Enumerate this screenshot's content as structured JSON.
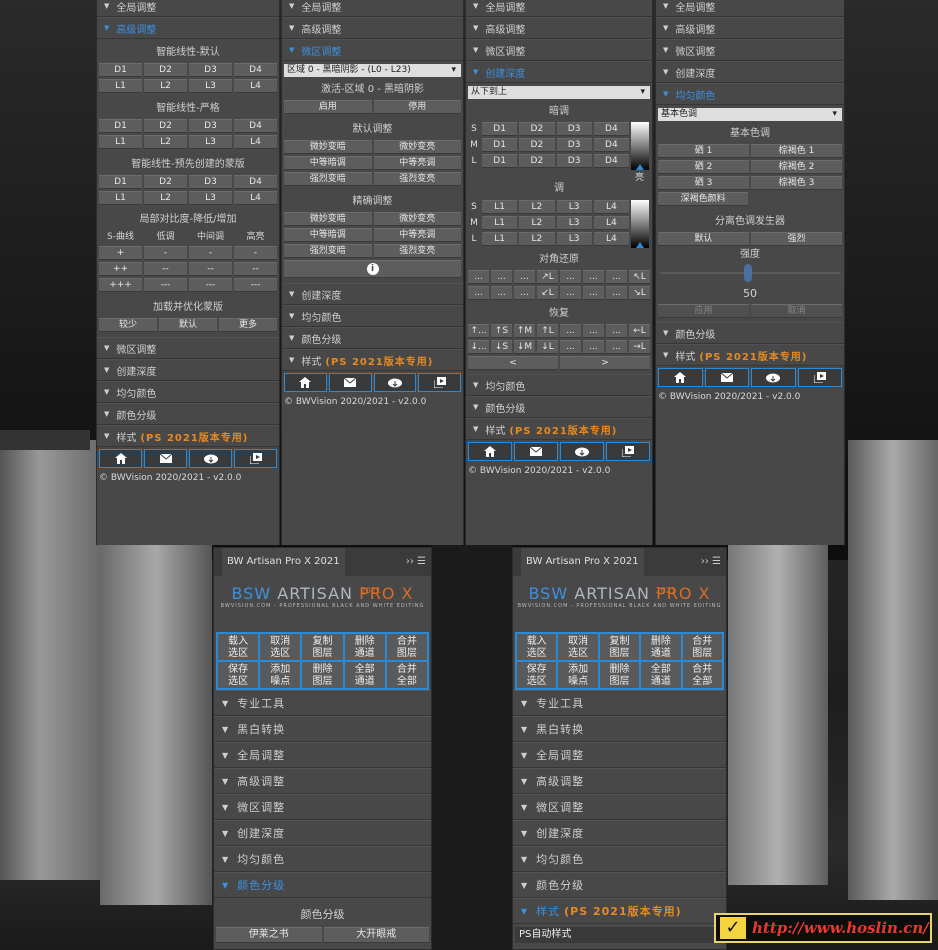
{
  "p1": {
    "top": "全局调整",
    "open": "高级调整",
    "lin_default": "智能线性-默认",
    "lin_strict": "智能线性-严格",
    "lin_mask": "智能线性-预先创建的蒙版",
    "d": [
      "D1",
      "D2",
      "D3",
      "D4"
    ],
    "l": [
      "L1",
      "L2",
      "L3",
      "L4"
    ],
    "local_title": "局部对比度-降低/增加",
    "curve_head": [
      "S-曲线",
      "低调",
      "中间调",
      "高亮"
    ],
    "curve_rows": [
      [
        "+",
        "-",
        "-",
        "-"
      ],
      [
        "++",
        "--",
        "--",
        "--"
      ],
      [
        "+++",
        "---",
        "---",
        "---"
      ]
    ],
    "mask_title": "加载并优化蒙版",
    "mask_btns": [
      "较少",
      "默认",
      "更多"
    ],
    "secs": [
      "微区调整",
      "创建深度",
      "均匀颜色",
      "颜色分级"
    ],
    "style": "样式",
    "style_org": "(PS 2021版本专用)",
    "copy": "© BWVision 2020/2021 - v2.0.0"
  },
  "p2": {
    "secs_top": [
      "全局调整",
      "高级调整"
    ],
    "open": "微区调整",
    "zone": "区域 0 - 黑暗阴影 - (L0 - L23)",
    "activate": "激活-区域 0 - 黑暗阴影",
    "en": [
      "启用",
      "停用"
    ],
    "def_title": "默认调整",
    "def_rows": [
      [
        "微妙变暗",
        "微妙变亮"
      ],
      [
        "中等暗调",
        "中等亮调"
      ],
      [
        "强烈变暗",
        "强烈变亮"
      ]
    ],
    "fine_title": "精确调整",
    "fine_rows": [
      [
        "微妙变暗",
        "微妙变亮"
      ],
      [
        "中等暗调",
        "中等亮调"
      ],
      [
        "强烈变暗",
        "强烈变亮"
      ]
    ],
    "info": "i",
    "secs": [
      "创建深度",
      "均匀颜色",
      "颜色分级"
    ],
    "style": "样式",
    "style_org": "(PS 2021版本专用)",
    "copy": "© BWVision 2020/2021 - v2.0.0"
  },
  "p3": {
    "secs_top": [
      "全局调整",
      "高级调整",
      "微区调整"
    ],
    "open": "创建深度",
    "dir": "从下到上",
    "dark": "暗调",
    "bright": "亮",
    "mid": "调",
    "sml": [
      "S",
      "M",
      "L"
    ],
    "d": [
      "D1",
      "D2",
      "D3",
      "D4"
    ],
    "l": [
      "L1",
      "L2",
      "L3",
      "L4"
    ],
    "diag": "对角还原",
    "diag_rows": [
      [
        "...",
        "...",
        "...",
        "↗L",
        "...",
        "...",
        "...",
        "↖L"
      ],
      [
        "...",
        "...",
        "...",
        "↙L",
        "...",
        "...",
        "...",
        "↘L"
      ]
    ],
    "restore": "恢复",
    "rest_rows": [
      [
        "↑...",
        "↑S",
        "↑M",
        "↑L",
        "...",
        "...",
        "...",
        "←L"
      ],
      [
        "↓...",
        "↓S",
        "↓M",
        "↓L",
        "...",
        "...",
        "...",
        "→L"
      ]
    ],
    "arrows": [
      "<",
      ">"
    ],
    "secs": [
      "均匀颜色",
      "颜色分级"
    ],
    "style": "样式",
    "style_org": "(PS 2021版本专用)",
    "copy": "© BWVision 2020/2021 - v2.0.0"
  },
  "p4": {
    "secs_top": [
      "全局调整",
      "高级调整",
      "微区调整",
      "创建深度"
    ],
    "open": "均匀颜色",
    "tone_dd": "基本色调",
    "tone_title": "基本色调",
    "tone_rows": [
      [
        "硒 1",
        "棕褐色 1"
      ],
      [
        "硒 2",
        "棕褐色 2"
      ],
      [
        "硒 3",
        "棕褐色 3"
      ]
    ],
    "pigment": "深褐色颜料",
    "split": "分离色调发生器",
    "split_btns": [
      "默认",
      "强烈"
    ],
    "strength": "强度",
    "value": "50",
    "apply": [
      "应用",
      "取消"
    ],
    "secs": [
      "颜色分级"
    ],
    "style": "样式",
    "style_org": "(PS 2021版本专用)",
    "copy": "© BWVision 2020/2021 - v2.0.0"
  },
  "b": {
    "title": "BW Artisan Pro X 2021",
    "logo": {
      "a": "BSW",
      "b": "ARTISAN",
      "c": "PRO X",
      "yr": "2021",
      "sub": "BWVISION.COM - PROFESSIONAL BLACK AND WHITE EDITING"
    },
    "grid": [
      "载入\n选区",
      "取消\n选区",
      "复制\n图层",
      "删除\n通道",
      "合并\n图层",
      "保存\n选区",
      "添加\n噪点",
      "删除\n图层",
      "全部\n通道",
      "合并\n全部"
    ],
    "secs": [
      "专业工具",
      "黑白转换",
      "全局调整",
      "高级调整",
      "微区调整",
      "创建深度",
      "均匀颜色"
    ],
    "open_l": "颜色分级",
    "grade_title": "颜色分级",
    "grade_btns": [
      "伊莱之书",
      "大开眼戒"
    ],
    "open_r": "样式",
    "open_r_org": "(PS 2021版本专用)",
    "r_secs": [
      "专业工具",
      "黑白转换",
      "全局调整",
      "高级调整",
      "微区调整",
      "创建深度",
      "均匀颜色",
      "颜色分级"
    ],
    "ps_style": "PS自动样式"
  },
  "watermark": "http://www.hoslin.cn/"
}
